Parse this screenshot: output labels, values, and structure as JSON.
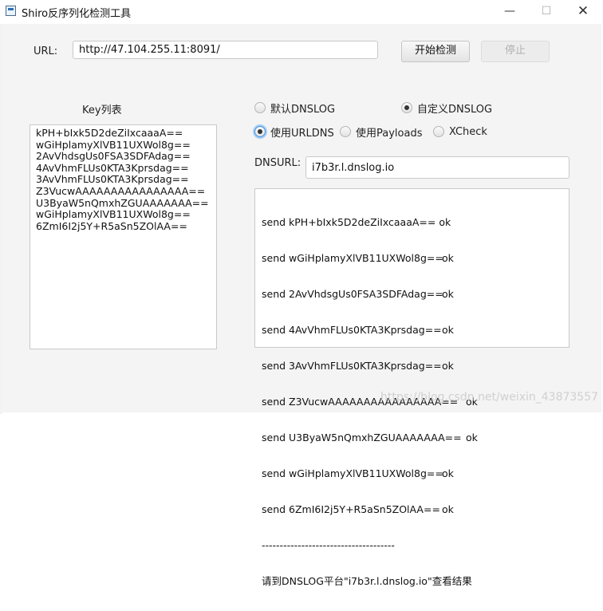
{
  "window": {
    "title": "Shiro反序列化检测工具",
    "controls": {
      "minimize": "—",
      "maximize": "☐",
      "close": "✕"
    }
  },
  "url": {
    "label": "URL:",
    "value": "http://47.104.255.11:8091/"
  },
  "buttons": {
    "start": "开始检测",
    "stop": "停止"
  },
  "key_list": {
    "title": "Key列表",
    "items": [
      "kPH+bIxk5D2deZiIxcaaaA==",
      "wGiHplamyXlVB11UXWol8g==",
      "2AvVhdsgUs0FSA3SDFAdag==",
      "4AvVhmFLUs0KTA3Kprsdag==",
      "3AvVhmFLUs0KTA3Kprsdag==",
      "Z3VucwAAAAAAAAAAAAAAAA==",
      "U3ByaW5nQmxhZGUAAAAAAA==",
      "wGiHplamyXlVB11UXWol8g==",
      "6ZmI6I2j5Y+R5aSn5ZOlAA=="
    ]
  },
  "dnslog_options": {
    "default": "默认DNSLOG",
    "custom": "自定义DNSLOG",
    "selected": "custom"
  },
  "mode_options": {
    "urldns": "使用URLDNS",
    "payloads": "使用Payloads",
    "xcheck": "XCheck",
    "selected": "urldns"
  },
  "dnsurl": {
    "label": "DNSURL:",
    "value": "i7b3r.l.dnslog.io"
  },
  "log": {
    "lines": [
      {
        "text": "send kPH+bIxk5D2deZiIxcaaaA== ok",
        "status": ""
      },
      {
        "text": "send wGiHplamyXlVB11UXWol8g==",
        "status": "ok"
      },
      {
        "text": "send 2AvVhdsgUs0FSA3SDFAdag==",
        "status": "ok"
      },
      {
        "text": "send 4AvVhmFLUs0KTA3Kprsdag==",
        "status": "ok"
      },
      {
        "text": "send 3AvVhmFLUs0KTA3Kprsdag==",
        "status": "ok"
      },
      {
        "text": "send Z3VucwAAAAAAAAAAAAAAAA==",
        "status": "ok"
      },
      {
        "text": "send U3ByaW5nQmxhZGUAAAAAAA==",
        "status": "ok"
      },
      {
        "text": "send wGiHplamyXlVB11UXWol8g==",
        "status": "ok"
      },
      {
        "text": "send 6ZmI6I2j5Y+R5aSn5ZOlAA==",
        "status": "ok"
      }
    ],
    "separator": "-------------------------------------",
    "result": "请到DNSLOG平台\"i7b3r.l.dnslog.io\"查看结果"
  },
  "watermark": "https://blog.csdn.net/weixin_43873557"
}
